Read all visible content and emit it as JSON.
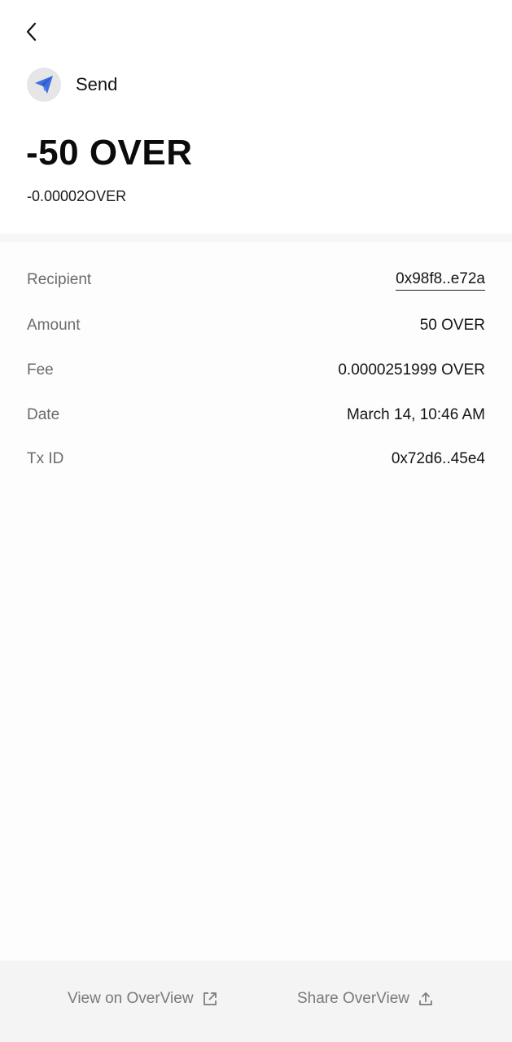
{
  "header": {
    "type_label": "Send",
    "amount": "-50 OVER",
    "gas_amount": "-0.00002OVER"
  },
  "details": [
    {
      "label": "Recipient",
      "value": "0x98f8..e72a"
    },
    {
      "label": "Amount",
      "value": "50 OVER"
    },
    {
      "label": "Fee",
      "value": "0.0000251999 OVER"
    },
    {
      "label": "Date",
      "value": "March 14, 10:46 AM"
    },
    {
      "label": "Tx ID",
      "value": "0x72d6..45e4"
    }
  ],
  "footer": {
    "view_label": "View on OverView",
    "share_label": "Share OverView"
  },
  "icons": {
    "back": "chevron-left-icon",
    "send": "paper-plane-icon",
    "external": "external-link-icon",
    "share": "share-upload-icon"
  },
  "colors": {
    "send_icon": "#3b6fe0",
    "send_icon_bg": "#e6e6e8",
    "label_gray": "#6b6b6e",
    "footer_bg": "#f4f4f4"
  }
}
